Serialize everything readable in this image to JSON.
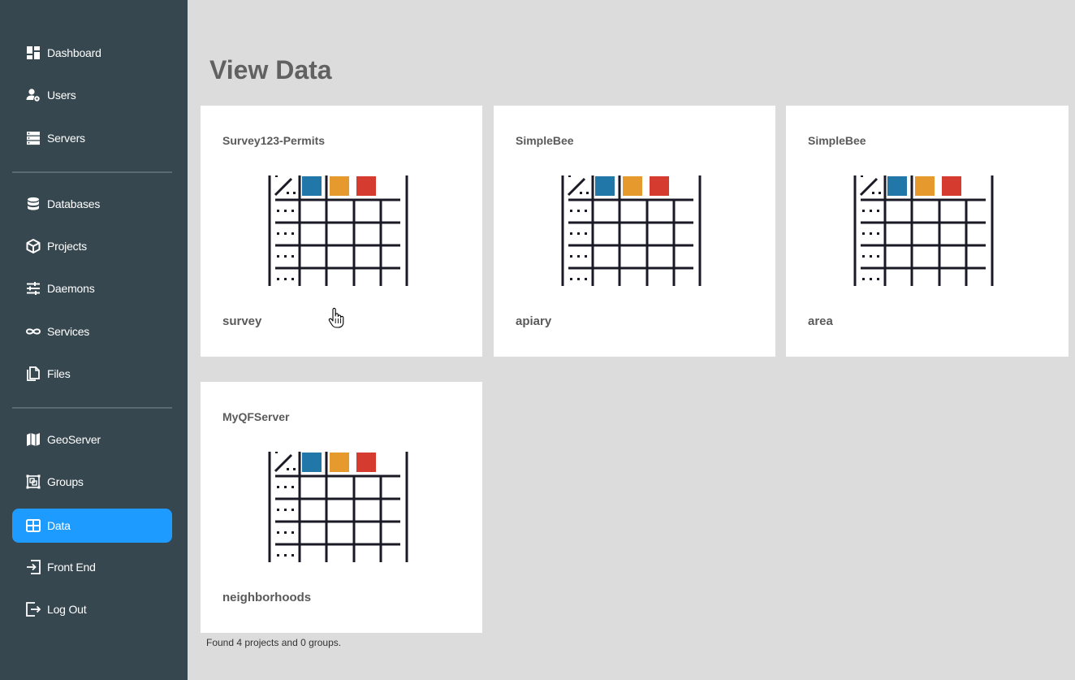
{
  "sidebar": {
    "groups": [
      [
        {
          "label": "Dashboard",
          "icon": "dashboard-icon"
        },
        {
          "label": "Users",
          "icon": "users-gear-icon"
        },
        {
          "label": "Servers",
          "icon": "servers-icon"
        }
      ],
      [
        {
          "label": "Databases",
          "icon": "database-icon"
        },
        {
          "label": "Projects",
          "icon": "cube-icon"
        },
        {
          "label": "Daemons",
          "icon": "sliders-icon"
        },
        {
          "label": "Services",
          "icon": "infinity-icon"
        },
        {
          "label": "Files",
          "icon": "files-icon"
        }
      ],
      [
        {
          "label": "GeoServer",
          "icon": "map-icon"
        },
        {
          "label": "Groups",
          "icon": "groups-icon"
        },
        {
          "label": "Data",
          "icon": "table-icon",
          "active": true
        },
        {
          "label": "Front End",
          "icon": "sign-in-icon"
        },
        {
          "label": "Log Out",
          "icon": "sign-out-icon"
        }
      ]
    ]
  },
  "main": {
    "title": "View Data",
    "cards": [
      {
        "server": "Survey123-Permits",
        "name": "survey"
      },
      {
        "server": "SimpleBee",
        "name": "apiary"
      },
      {
        "server": "SimpleBee",
        "name": "area"
      },
      {
        "server": "MyQFServer",
        "name": "neighborhoods"
      }
    ],
    "footer": "Found 4 projects and 0 groups."
  },
  "colors": {
    "sidebar_bg": "#37474f",
    "active_bg": "#1e9bff",
    "page_bg": "#dcdcdc",
    "swatch_blue": "#2178a8",
    "swatch_orange": "#e6992c",
    "swatch_red": "#d63b2f"
  }
}
